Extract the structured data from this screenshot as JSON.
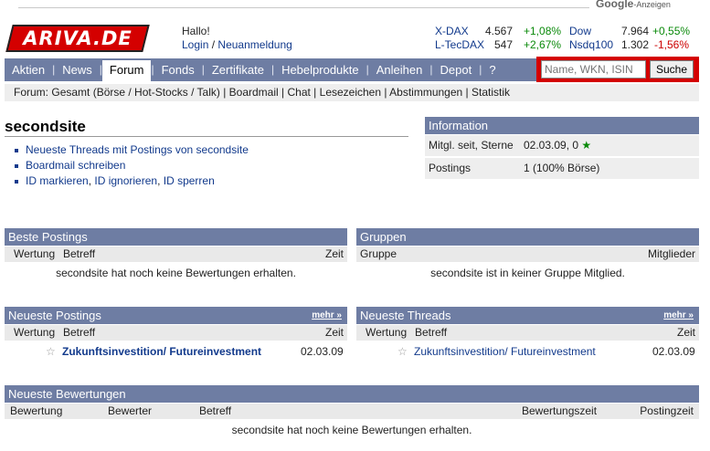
{
  "ads": {
    "google_label": "Google",
    "ads_suffix": "-Anzeigen"
  },
  "header": {
    "logo": "ARIVA.DE",
    "greeting": "Hallo!",
    "login": "Login",
    "slash": "/",
    "register": "Neuanmeldung"
  },
  "ticker": [
    {
      "name": "X-DAX",
      "value": "4.567",
      "change": "+1,08%",
      "name2": "Dow",
      "value2": "7.964",
      "change2": "+0,55%"
    },
    {
      "name": "L-TecDAX",
      "value": "547",
      "change": "+2,67%",
      "name2": "Nsdq100",
      "value2": "1.302",
      "change2": "-1,56%"
    }
  ],
  "colors": {
    "nav": "#6e7da3",
    "brand_red": "#d40000",
    "positive": "#0a8a0a",
    "negative": "#cc0000",
    "link": "#123a8c"
  },
  "nav": {
    "items": [
      "Aktien",
      "News",
      "Forum",
      "Fonds",
      "Zertifikate",
      "Hebelprodukte",
      "Anleihen",
      "Depot",
      "?"
    ],
    "active": "Forum",
    "separator": "|"
  },
  "search": {
    "placeholder": "Name, WKN, ISIN",
    "button": "Suche"
  },
  "subnav": {
    "prefix": "Forum:",
    "items": [
      "Gesamt (Börse / Hot-Stocks / Talk)",
      "Boardmail",
      "Chat",
      "Lesezeichen",
      "Abstimmungen",
      "Statistik"
    ]
  },
  "profile": {
    "username": "secondsite",
    "links": [
      "Neueste Threads mit Postings von secondsite",
      "Boardmail schreiben"
    ],
    "id_actions": [
      "ID markieren",
      "ID ignorieren",
      "ID sperren"
    ]
  },
  "info": {
    "title": "Information",
    "rows": [
      {
        "label": "Mitgl. seit, Sterne",
        "value": "02.03.09, 0",
        "star_icon": "star-icon"
      },
      {
        "label": "Postings",
        "value": "1 (100% Börse)"
      }
    ]
  },
  "beste_postings": {
    "title": "Beste Postings",
    "cols": [
      "Wertung",
      "Betreff",
      "Zeit"
    ],
    "empty": "secondsite hat noch keine Bewertungen erhalten."
  },
  "gruppen": {
    "title": "Gruppen",
    "cols": [
      "Gruppe",
      "Mitglieder"
    ],
    "empty": "secondsite ist in keiner Gruppe Mitglied."
  },
  "neueste_postings": {
    "title": "Neueste Postings",
    "more": "mehr »",
    "cols": [
      "Wertung",
      "Betreff",
      "Zeit"
    ],
    "row": {
      "subject": "Zukunftsinvestition/ Futureinvestment",
      "time": "02.03.09"
    }
  },
  "neueste_threads": {
    "title": "Neueste Threads",
    "more": "mehr »",
    "cols": [
      "Wertung",
      "Betreff",
      "Zeit"
    ],
    "row": {
      "subject": "Zukunftsinvestition/ Futureinvestment",
      "time": "02.03.09"
    }
  },
  "neueste_bewertungen": {
    "title": "Neueste Bewertungen",
    "cols": [
      "Bewertung",
      "Bewerter",
      "Betreff",
      "Bewertungszeit",
      "Postingzeit"
    ],
    "empty": "secondsite hat noch keine Bewertungen erhalten."
  }
}
